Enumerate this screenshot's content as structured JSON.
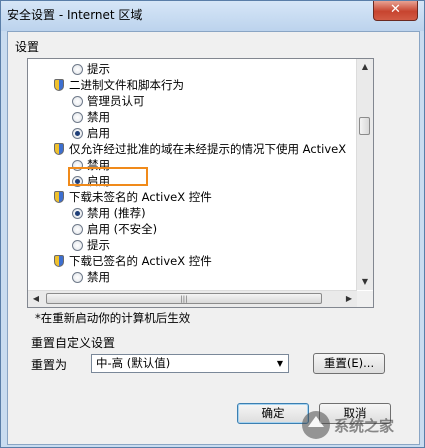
{
  "window": {
    "title": "安全设置 - Internet 区域",
    "close_glyph": "✕"
  },
  "settings": {
    "label": "设置",
    "tree": [
      {
        "kind": "radio",
        "text": "提示",
        "checked": false,
        "indent": 2
      },
      {
        "kind": "group",
        "text": "二进制文件和脚本行为",
        "indent": 1
      },
      {
        "kind": "radio",
        "text": "管理员认可",
        "checked": false,
        "indent": 2
      },
      {
        "kind": "radio",
        "text": "禁用",
        "checked": false,
        "indent": 2
      },
      {
        "kind": "radio",
        "text": "启用",
        "checked": true,
        "indent": 2
      },
      {
        "kind": "group",
        "text": "仅允许经过批准的域在未经提示的情况下使用 ActiveX",
        "indent": 1
      },
      {
        "kind": "radio",
        "text": "禁用",
        "checked": false,
        "indent": 2
      },
      {
        "kind": "radio",
        "text": "启用",
        "checked": true,
        "indent": 2,
        "highlighted": true
      },
      {
        "kind": "group",
        "text": "下载未签名的 ActiveX 控件",
        "indent": 1
      },
      {
        "kind": "radio",
        "text": "禁用 (推荐)",
        "checked": true,
        "indent": 2
      },
      {
        "kind": "radio",
        "text": "启用 (不安全)",
        "checked": false,
        "indent": 2
      },
      {
        "kind": "radio",
        "text": "提示",
        "checked": false,
        "indent": 2
      },
      {
        "kind": "group",
        "text": "下载已签名的 ActiveX 控件",
        "indent": 1
      },
      {
        "kind": "radio",
        "text": "禁用",
        "checked": false,
        "indent": 2
      }
    ],
    "scroll_up": "▲",
    "scroll_down": "▼",
    "scroll_left": "◀",
    "scroll_right": "▶",
    "hthumb_grip": "|||",
    "note": "*在重新启动你的计算机后生效"
  },
  "reset": {
    "group_label": "重置自定义设置",
    "reset_to_label": "重置为",
    "combo_value": "中-高 (默认值)",
    "combo_arrow": "▼",
    "reset_button": "重置(E)..."
  },
  "footer": {
    "ok_label": "确定",
    "cancel_label": "取消"
  },
  "watermark": {
    "text": "系统之家"
  }
}
